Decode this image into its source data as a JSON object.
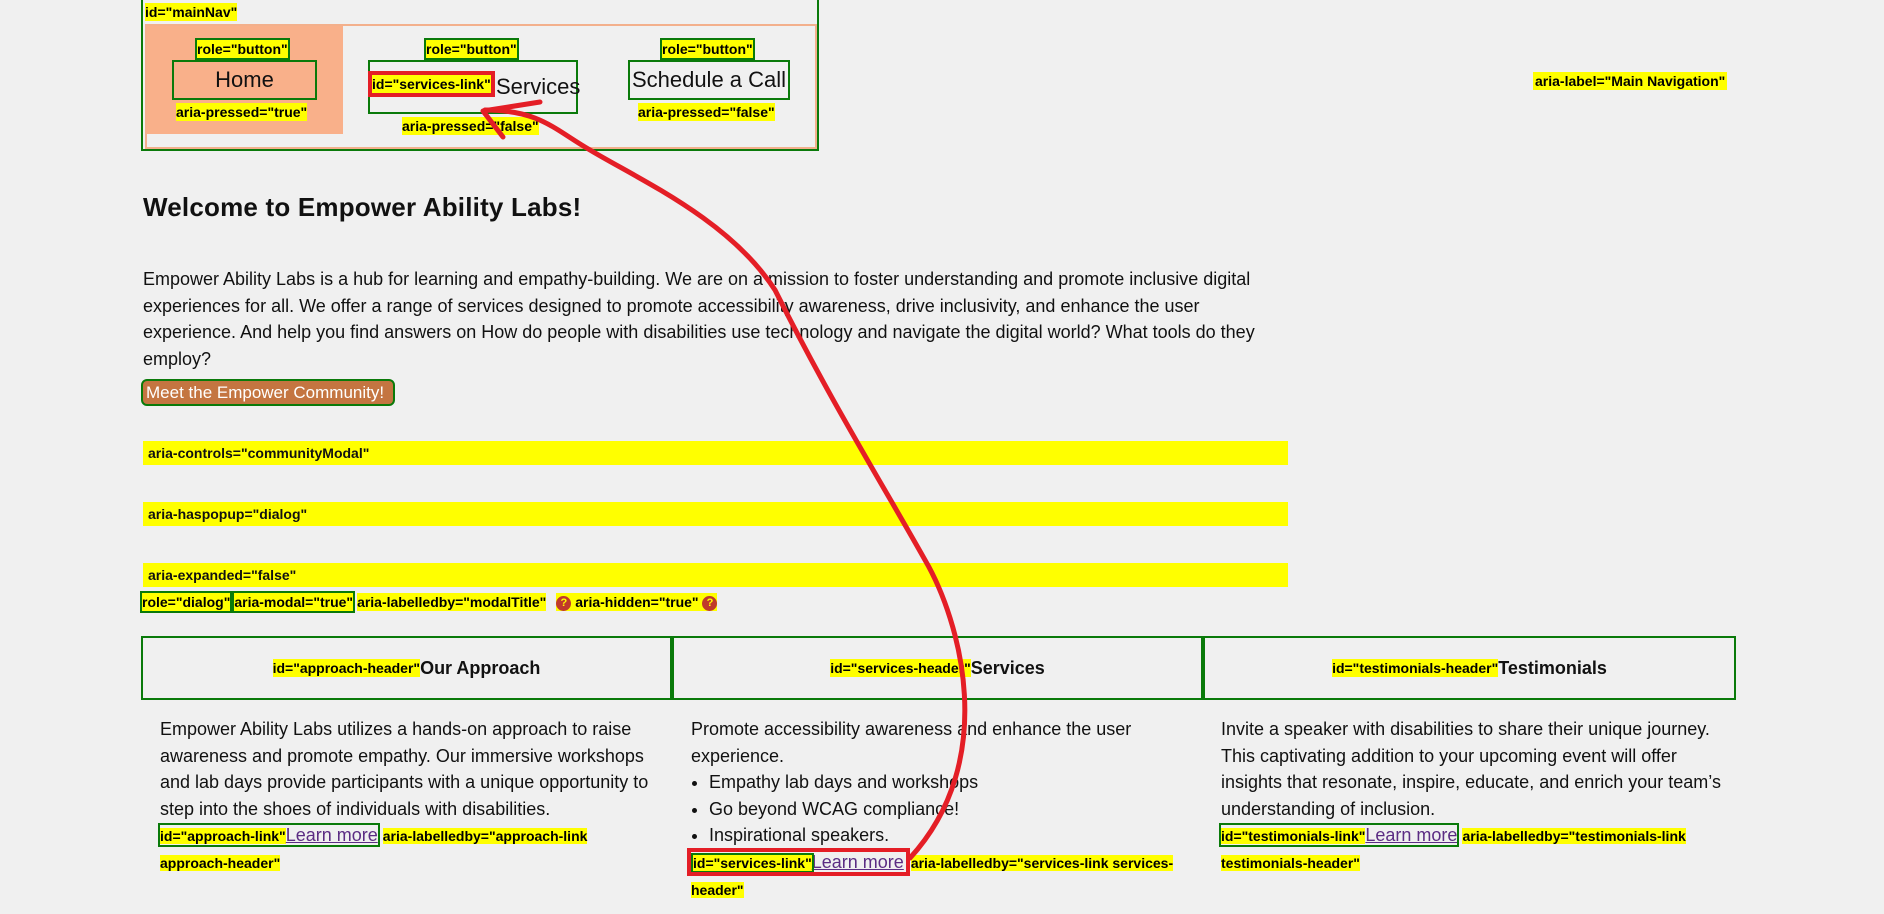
{
  "nav": {
    "main_nav_attr": "id=\"mainNav\"",
    "aria_label_attr": "aria-label=\"Main Navigation\"",
    "buttons": [
      {
        "label": "Home",
        "role_attr": "role=\"button\"",
        "pressed_attr": "aria-pressed=\"true\""
      },
      {
        "label": "Services",
        "role_attr": "role=\"button\"",
        "pressed_attr": "aria-pressed=\"false\"",
        "id_attr": "id=\"services-link\""
      },
      {
        "label": "Schedule a Call",
        "role_attr": "role=\"button\"",
        "pressed_attr": "aria-pressed=\"false\""
      }
    ]
  },
  "main": {
    "title": "Welcome to Empower Ability Labs!",
    "intro": "Empower Ability Labs is a hub for learning and empathy-building. We are on a mission to foster understanding and promote inclusive digital experiences for all. We offer a range of services designed to promote accessibility awareness, drive inclusivity, and enhance the user experience. And help you find answers on How do people with disabilities use technology and navigate the digital world? What tools do they employ?",
    "community_button": "Meet the Empower Community!",
    "bars": [
      "aria-controls=\"communityModal\"",
      "aria-haspopup=\"dialog\"",
      "aria-expanded=\"false\""
    ],
    "dialog_attrs": {
      "role": "role=\"dialog\"",
      "modal": "aria-modal=\"true\"",
      "labelledby": "aria-labelledby=\"modalTitle\"",
      "hidden": "aria-hidden=\"true\"",
      "hidden_marker": "?"
    }
  },
  "columns": [
    {
      "id_attr": "id=\"approach-header\"",
      "heading": "Our Approach",
      "text": "Empower Ability Labs utilizes a hands-on approach to raise awareness and promote empathy. Our immersive workshops and lab days provide participants with a unique opportunity to step into the shoes of individuals with disabilities.",
      "link_id_attr": "id=\"approach-link\"",
      "link_label": "Learn more",
      "labelledby_attr": "aria-labelledby=\"approach-link approach-header\""
    },
    {
      "id_attr": "id=\"services-header\"",
      "heading": "Services",
      "text": "Promote accessibility awareness and enhance the user experience.",
      "bullets": [
        "Empathy lab days and workshops",
        "Go beyond WCAG compliance!",
        "Inspirational speakers."
      ],
      "link_id_attr": "id=\"services-link\"",
      "link_label": "Learn more",
      "labelledby_attr": "aria-labelledby=\"services-link services-header\""
    },
    {
      "id_attr": "id=\"testimonials-header\"",
      "heading": "Testimonials",
      "text": "Invite a speaker with disabilities to share their unique journey. This captivating addition to your upcoming event will offer insights that resonate, inspire, educate, and enrich your team’s understanding of inclusion.",
      "link_id_attr": "id=\"testimonials-link\"",
      "link_label": "Learn more",
      "labelledby_attr": "aria-labelledby=\"testimonials-link testimonials-header\""
    }
  ],
  "colors": {
    "annotation_yellow": "#ffff00",
    "outline_green": "#0a7a0a",
    "annotation_red": "#e41e26",
    "button_orange": "#c47541",
    "home_bg": "#f9b08a"
  }
}
